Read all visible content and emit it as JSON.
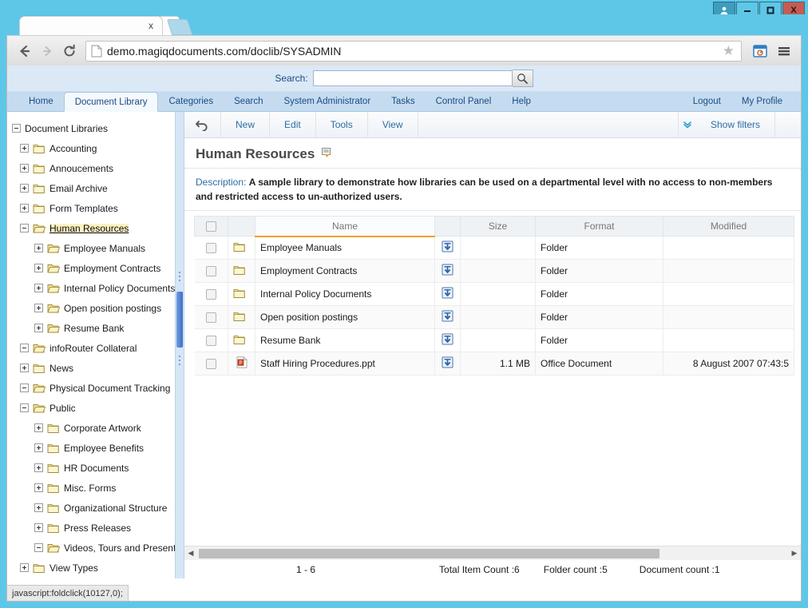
{
  "window": {
    "controls": {
      "user_icon": "user-icon",
      "minimize": "–",
      "maximize": "□",
      "close": "X"
    }
  },
  "browser": {
    "tab": {
      "title": "",
      "close_label": "x"
    },
    "new_tab_label": "+",
    "nav": {
      "back": "back-arrow-icon",
      "forward": "forward-arrow-icon",
      "reload": "reload-icon"
    },
    "url": "demo.magiqdocuments.com/doclib/SYSADMIN",
    "star_icon": "star-icon",
    "apps_icon": "extension-icon",
    "menu_icon": "hamburger-menu-icon"
  },
  "app": {
    "search": {
      "label": "Search:",
      "value": "",
      "placeholder": "",
      "button_icon": "magnifier-icon"
    },
    "nav": {
      "left": [
        {
          "label": "Home",
          "active": false
        },
        {
          "label": "Document Library",
          "active": true
        },
        {
          "label": "Categories",
          "active": false
        },
        {
          "label": "Search",
          "active": false
        },
        {
          "label": "System Administrator",
          "active": false
        },
        {
          "label": "Tasks",
          "active": false
        },
        {
          "label": "Control Panel",
          "active": false
        },
        {
          "label": "Help",
          "active": false
        }
      ],
      "right": [
        {
          "label": "Logout"
        },
        {
          "label": "My Profile"
        }
      ]
    },
    "sidebar": {
      "root": {
        "label": "Document Libraries",
        "expanded": true
      },
      "items": [
        {
          "label": "Accounting",
          "level": 1,
          "state": "collapsed",
          "icon": "folder-icon",
          "selected": false
        },
        {
          "label": "Annoucements",
          "level": 1,
          "state": "collapsed",
          "icon": "folder-icon",
          "selected": false
        },
        {
          "label": "Email Archive",
          "level": 1,
          "state": "collapsed",
          "icon": "folder-icon",
          "selected": false
        },
        {
          "label": "Form Templates",
          "level": 1,
          "state": "collapsed",
          "icon": "folder-icon",
          "selected": false
        },
        {
          "label": "Human Resources",
          "level": 1,
          "state": "expanded",
          "icon": "folder-open-icon",
          "selected": true
        },
        {
          "label": "Employee Manuals",
          "level": 2,
          "state": "collapsed",
          "icon": "folder-open-icon",
          "selected": false
        },
        {
          "label": "Employment Contracts",
          "level": 2,
          "state": "collapsed",
          "icon": "folder-open-icon",
          "selected": false
        },
        {
          "label": "Internal Policy Documents",
          "level": 2,
          "state": "collapsed",
          "icon": "folder-open-icon",
          "selected": false
        },
        {
          "label": "Open position postings",
          "level": 2,
          "state": "collapsed",
          "icon": "folder-open-icon",
          "selected": false
        },
        {
          "label": "Resume Bank",
          "level": 2,
          "state": "collapsed",
          "icon": "folder-open-icon",
          "selected": false
        },
        {
          "label": "infoRouter Collateral",
          "level": 1,
          "state": "expanded",
          "icon": "folder-open-icon",
          "selected": false
        },
        {
          "label": "News",
          "level": 1,
          "state": "collapsed",
          "icon": "folder-icon",
          "selected": false
        },
        {
          "label": "Physical Document Tracking",
          "level": 1,
          "state": "expanded",
          "icon": "folder-open-icon",
          "selected": false
        },
        {
          "label": "Public",
          "level": 1,
          "state": "expanded",
          "icon": "folder-open-icon",
          "selected": false
        },
        {
          "label": "Corporate Artwork",
          "level": 2,
          "state": "collapsed",
          "icon": "folder-icon",
          "selected": false
        },
        {
          "label": "Employee Benefits",
          "level": 2,
          "state": "collapsed",
          "icon": "folder-icon",
          "selected": false
        },
        {
          "label": "HR Documents",
          "level": 2,
          "state": "collapsed",
          "icon": "folder-icon",
          "selected": false
        },
        {
          "label": "Misc. Forms",
          "level": 2,
          "state": "collapsed",
          "icon": "folder-icon",
          "selected": false
        },
        {
          "label": "Organizational Structure",
          "level": 2,
          "state": "collapsed",
          "icon": "folder-icon",
          "selected": false
        },
        {
          "label": "Press Releases",
          "level": 2,
          "state": "collapsed",
          "icon": "folder-icon",
          "selected": false
        },
        {
          "label": "Videos, Tours and Presentat",
          "level": 2,
          "state": "expanded",
          "icon": "folder-open-icon",
          "selected": false
        },
        {
          "label": "View Types",
          "level": 1,
          "state": "collapsed",
          "icon": "folder-icon",
          "selected": false
        }
      ]
    },
    "toolbar": {
      "back_icon": "undo-arrow-icon",
      "new": "New",
      "edit": "Edit",
      "tools": "Tools",
      "view": "View",
      "chevron_icon": "double-chevron-down-icon",
      "show_filters": "Show filters"
    },
    "page": {
      "title": "Human Resources",
      "title_icon": "properties-icon",
      "description_label": "Description:",
      "description_text": "A sample library to demonstrate how libraries can be used on a departmental level with no access to non-members and restricted access to un-authorized users."
    },
    "table": {
      "columns": [
        "",
        "",
        "Name",
        "",
        "Size",
        "Format",
        "Modified"
      ],
      "sorted_column": "Name",
      "rows": [
        {
          "name": "Employee Manuals",
          "icon": "folder-icon",
          "download": "download-icon",
          "size": "",
          "format": "Folder",
          "modified": ""
        },
        {
          "name": "Employment Contracts",
          "icon": "folder-icon",
          "download": "download-icon",
          "size": "",
          "format": "Folder",
          "modified": ""
        },
        {
          "name": "Internal Policy Documents",
          "icon": "folder-icon",
          "download": "download-icon",
          "size": "",
          "format": "Folder",
          "modified": ""
        },
        {
          "name": "Open position postings",
          "icon": "folder-icon",
          "download": "download-icon",
          "size": "",
          "format": "Folder",
          "modified": ""
        },
        {
          "name": "Resume Bank",
          "icon": "folder-icon",
          "download": "download-icon",
          "size": "",
          "format": "Folder",
          "modified": ""
        },
        {
          "name": "Staff Hiring Procedures.ppt",
          "icon": "powerpoint-icon",
          "download": "download-icon",
          "size": "1.1 MB",
          "format": "Office Document",
          "modified": "8 August 2007 07:43:5"
        }
      ]
    },
    "status": {
      "paging": "1 - 6",
      "total_item_count": "Total Item Count :6",
      "folder_count": "Folder count :5",
      "document_count": "Document count :1"
    },
    "link_status": "javascript:foldclick(10127,0);"
  },
  "colors": {
    "frame": "#5ec7e8",
    "close_button": "#c55b52",
    "nav_band": "#c5dcf0",
    "search_band": "#dbe9f7",
    "accent_orange": "#f0a22e",
    "link_blue": "#2e6da4",
    "selection_highlight": "#fdf3c4"
  }
}
